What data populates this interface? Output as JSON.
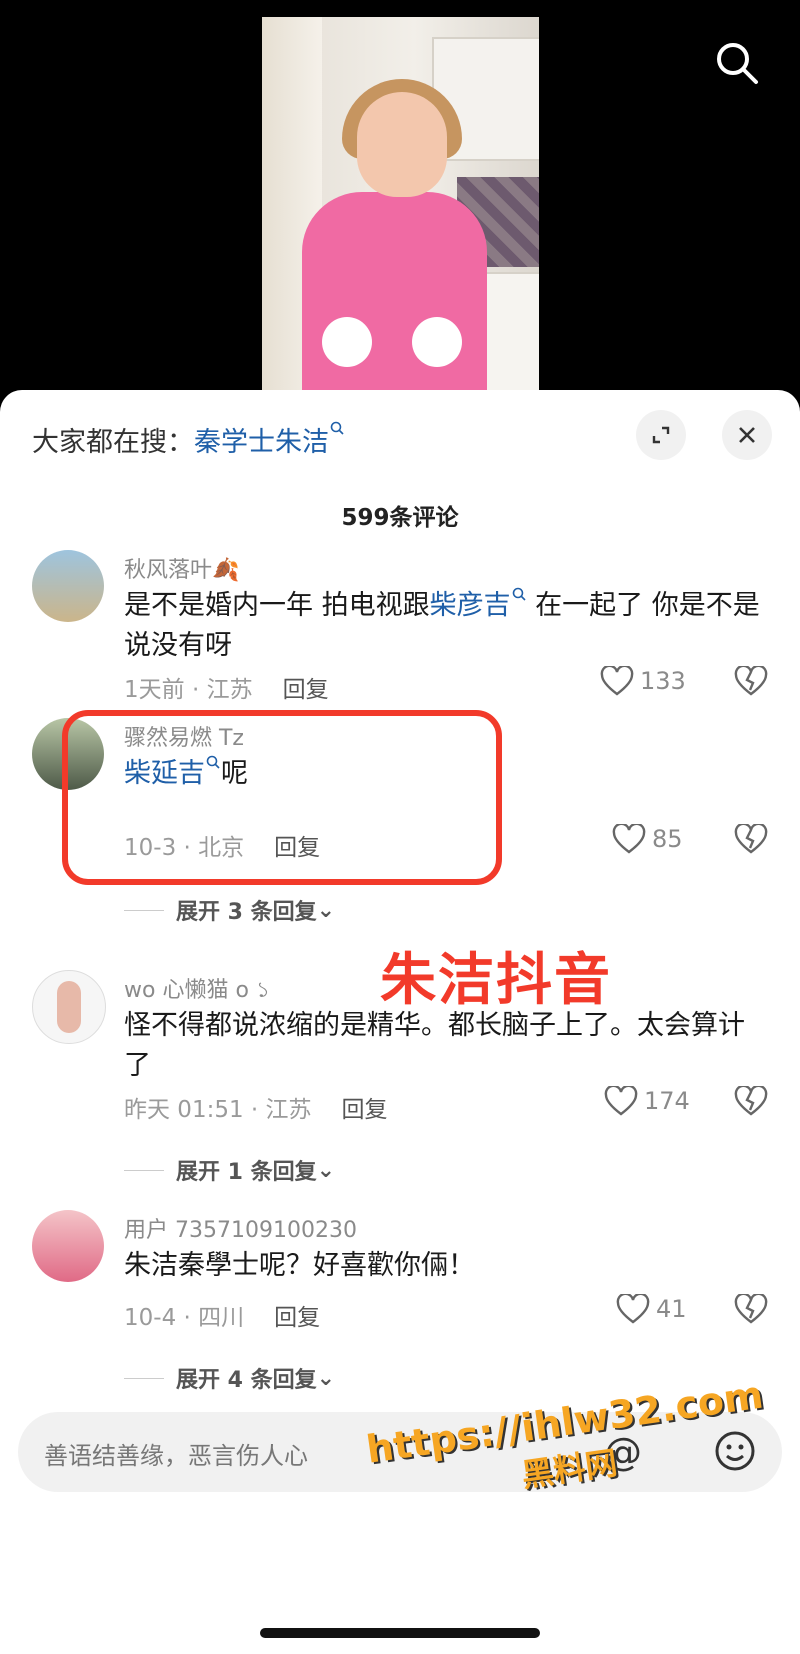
{
  "header": {
    "hot_label": "大家都在搜：",
    "hot_keyword": "秦学士朱洁"
  },
  "comments_count": "599条评论",
  "comments": [
    {
      "user": "秋风落叶🍂",
      "text_pre": "是不是婚内一年 拍电视跟",
      "keyword": "柴彦吉",
      "text_post": " 在一起了 你是不是说没有呀",
      "time": "1天前 · 江苏",
      "reply": "回复",
      "likes": "133"
    },
    {
      "user": "骤然易燃 Tz",
      "text_pre": "",
      "keyword": "柴延吉",
      "text_post": "呢",
      "time": "10-3 · 北京",
      "reply": "回复",
      "likes": "85",
      "expand": "展开 3 条回复"
    },
    {
      "user": "wo 心懒猫 o ১",
      "text_pre": "怪不得都说浓缩的是精华。都长脑子上了。太会算计了",
      "keyword": "",
      "text_post": "",
      "time": "昨天 01:51 · 江苏",
      "reply": "回复",
      "likes": "174",
      "expand": "展开 1 条回复"
    },
    {
      "user": "用户 7357109100230",
      "text_pre": "朱洁秦學士呢？好喜歡你倆！",
      "keyword": "",
      "text_post": "",
      "time": "10-4 · 四川",
      "reply": "回复",
      "likes": "41",
      "expand": "展开 4 条回复"
    }
  ],
  "overlay_text": "朱洁抖音",
  "input": {
    "placeholder": "善语结善缘，恶言伤人心"
  },
  "watermark": {
    "line1": "https://ihlw32.com",
    "line2": "黑料网"
  },
  "colors": {
    "keyword": "#1f5fa8",
    "overlay": "#f23a2a",
    "watermark": "#f6a623"
  }
}
